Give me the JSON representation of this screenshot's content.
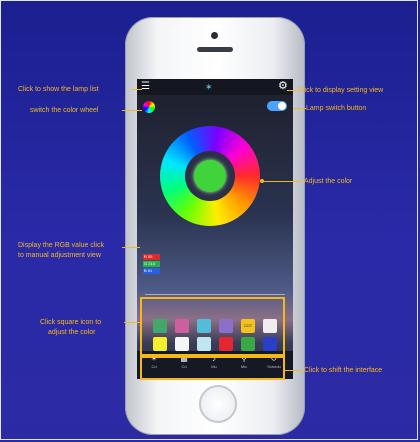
{
  "annotations": {
    "lamp_list": "Click to show the lamp list",
    "display_setting": "Click to  display setting view",
    "color_wheel": "switch the color wheel",
    "lamp_switch": "Lamp switch button",
    "adjust_color": "Adjust the color",
    "rgb_value_line1": "Display the RGB value click",
    "rgb_value_line2": "to manual adjustment view",
    "square_icon_line1": "Click square icon to",
    "square_icon_line2": "adjust the color",
    "shift_interface": "Click to shift the interface"
  },
  "screen": {
    "rgb": {
      "r": "R 55",
      "g": "G 213",
      "b": "B 51"
    },
    "wheel_center_color": "#3fd43a",
    "swatch_row1": [
      "#41a86a",
      "#cc5fa0",
      "#55bcd8",
      "#8b6fc8",
      "#f2c21e",
      "#eeeeee"
    ],
    "swatch_row1_labels": [
      "",
      "",
      "",
      "",
      "COT",
      ""
    ],
    "swatch_row2": [
      "#f5ee2a",
      "#f5f5f5",
      "#bfe6f2",
      "#e3262f",
      "#3aa845",
      "#2a3fc9"
    ],
    "tabs": [
      {
        "label": "Cd",
        "icon": "color-icon"
      },
      {
        "label": "Cd",
        "icon": "mode-icon"
      },
      {
        "label": "Mu",
        "icon": "music-icon"
      },
      {
        "label": "Mic",
        "icon": "mic-icon"
      },
      {
        "label": "Schedu",
        "icon": "timer-icon"
      }
    ]
  },
  "colors": {
    "background": "#2a2aa8",
    "annotation": "#f5b81c"
  }
}
